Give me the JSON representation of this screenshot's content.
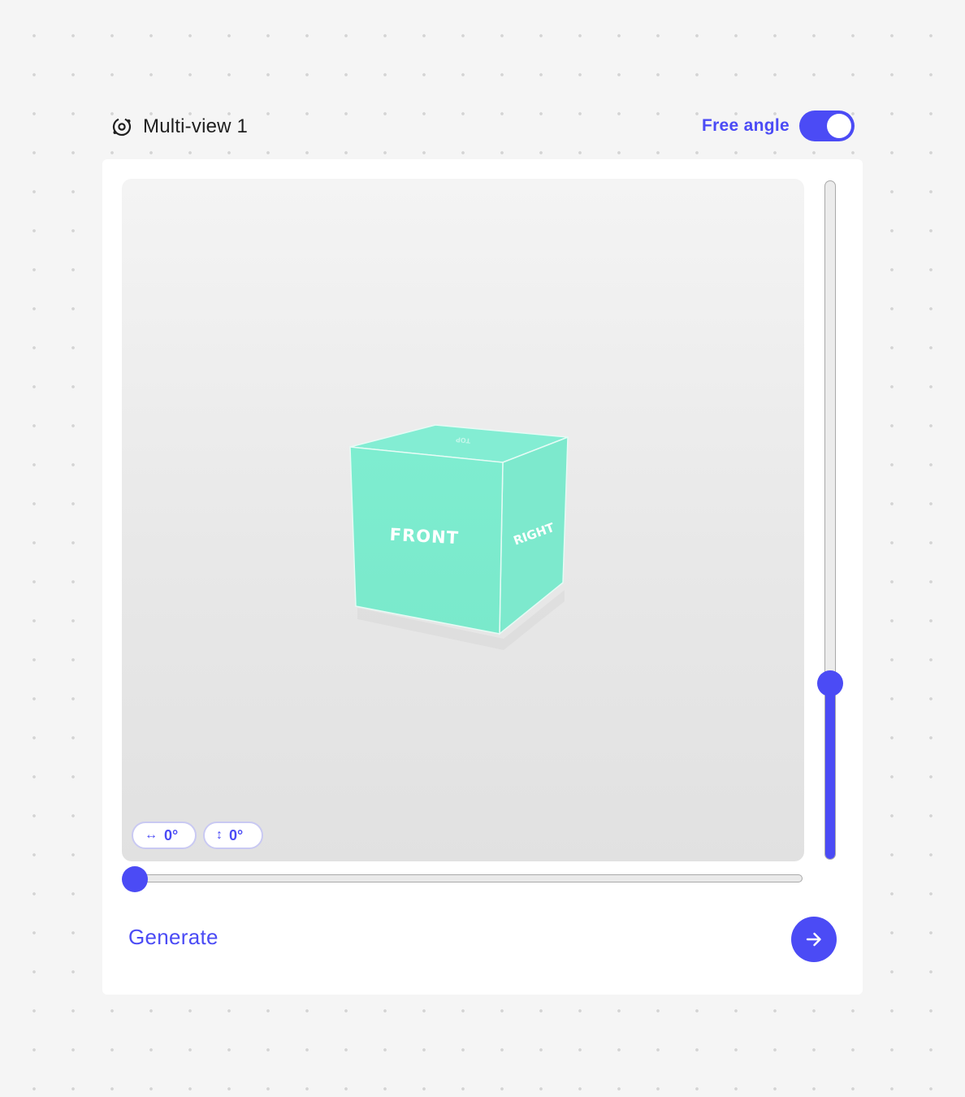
{
  "node": {
    "title": "Multi-view 1",
    "icon": "orbit-camera-icon"
  },
  "free_angle": {
    "label": "Free angle",
    "enabled": true
  },
  "viewport": {
    "cube_faces": {
      "front": "FRONT",
      "right": "RIGHT",
      "top": "TOP"
    },
    "cube_color": "#7eebcf",
    "horizontal_angle_chip": {
      "icon": "horizontal-arrows-icon",
      "glyph": "↔",
      "value": "0°"
    },
    "vertical_angle_chip": {
      "icon": "vertical-arrows-icon",
      "glyph": "↕",
      "value": "0°"
    }
  },
  "sliders": {
    "horizontal": {
      "fraction": 0.0
    },
    "vertical": {
      "fraction": 0.26
    }
  },
  "footer": {
    "generate_label": "Generate",
    "submit_icon": "arrow-right-icon"
  },
  "colors": {
    "accent": "#4b4bf5",
    "background": "#f5f5f5",
    "card": "#ffffff"
  }
}
